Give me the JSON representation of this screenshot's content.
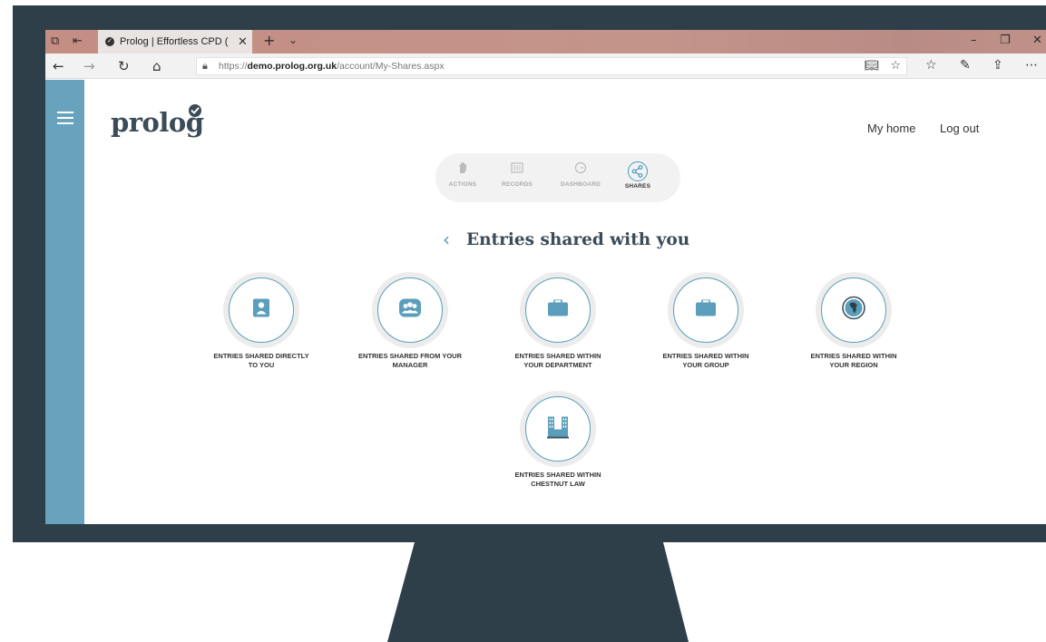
{
  "browser": {
    "tab_title": "Prolog | Effortless CPD (",
    "tab_close": "✕",
    "new_tab": "+",
    "tab_dropdown": "⌄",
    "url_prefix": "https://",
    "url_domain": "demo.prolog.org.uk",
    "url_path": "/account/My-Shares.aspx",
    "window_controls": [
      "–",
      "❐",
      "✕"
    ],
    "nav_icons": [
      "back-icon",
      "forward-icon",
      "refresh-icon",
      "home-icon"
    ],
    "toolbar_icons": [
      "reading-view-icon",
      "favorite-star-icon",
      "favorites-list-icon",
      "pen-icon",
      "share-icon",
      "more-icon"
    ]
  },
  "site": {
    "logo_text": "prolog",
    "links": {
      "my_home": "My home",
      "log_out": "Log out"
    },
    "segmented_nav": [
      {
        "label": "ACTIONS",
        "icon": "hand-icon",
        "active": false
      },
      {
        "label": "RECORDS",
        "icon": "records-icon",
        "active": false
      },
      {
        "label": "DASHBOARD",
        "icon": "dashboard-icon",
        "active": false
      },
      {
        "label": "SHARES",
        "icon": "share-icon",
        "active": true
      }
    ],
    "heading": "Entries shared with you",
    "cards": [
      {
        "line1": "ENTRIES SHARED DIRECTLY",
        "line2": "TO YOU",
        "icon": "person-icon"
      },
      {
        "line1": "ENTRIES SHARED FROM YOUR",
        "line2": "MANAGER",
        "icon": "group-icon"
      },
      {
        "line1": "ENTRIES SHARED WITHIN",
        "line2": "YOUR DEPARTMENT",
        "icon": "briefcase-icon"
      },
      {
        "line1": "ENTRIES SHARED WITHIN",
        "line2": "YOUR GROUP",
        "icon": "briefcase-icon"
      },
      {
        "line1": "ENTRIES SHARED WITHIN",
        "line2": "YOUR REGION",
        "icon": "globe-icon"
      },
      {
        "line1": "ENTRIES SHARED WITHIN",
        "line2": "CHESTNUT LAW",
        "icon": "building-icon"
      }
    ]
  },
  "colors": {
    "sidebar": "#67a3bd",
    "accent": "#4b9bbd",
    "icon_fill": "#5a9ebb",
    "logo": "#3b4b57",
    "monitor": "#2f3f4a",
    "titlebar": "#c58e84"
  }
}
